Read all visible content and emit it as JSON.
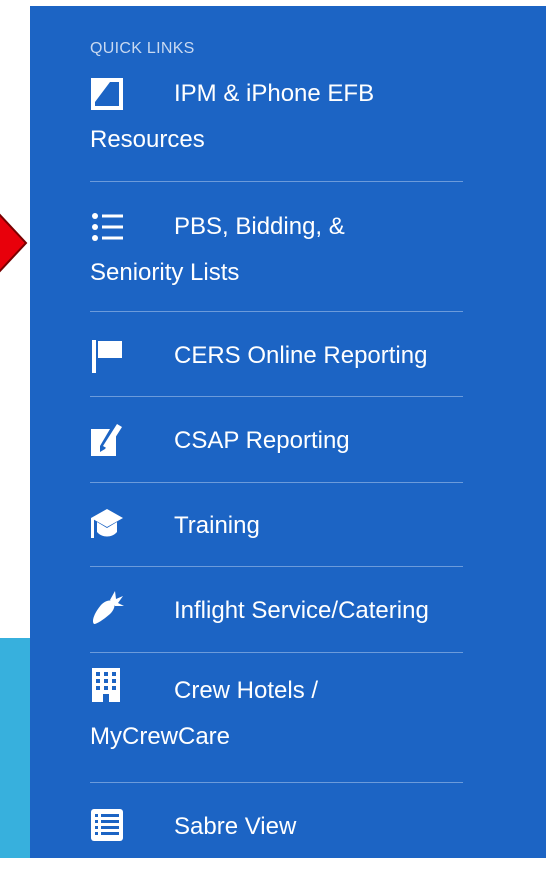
{
  "colors": {
    "panel": "#1c64c4",
    "band": "#37b0dd",
    "arrow": "#e8000b",
    "text": "#ffffff",
    "header": "#c8d9f1",
    "divider": "#6b9bdb"
  },
  "quick_links": {
    "header": "QUICK LINKS",
    "items": [
      {
        "icon": "document-icon",
        "line1": "IPM & iPhone EFB",
        "line2": "Resources"
      },
      {
        "icon": "list-icon",
        "line1": "PBS, Bidding, &",
        "line2": "Seniority Lists"
      },
      {
        "icon": "flag-icon",
        "label": "CERS Online Reporting"
      },
      {
        "icon": "edit-note-icon",
        "label": "CSAP Reporting"
      },
      {
        "icon": "graduation-cap-icon",
        "label": "Training"
      },
      {
        "icon": "carrot-icon",
        "label": "Inflight Service/Catering"
      },
      {
        "icon": "building-icon",
        "line1": "Crew Hotels /",
        "line2": "MyCrewCare"
      },
      {
        "icon": "list-box-icon",
        "label": "Sabre View"
      }
    ]
  }
}
